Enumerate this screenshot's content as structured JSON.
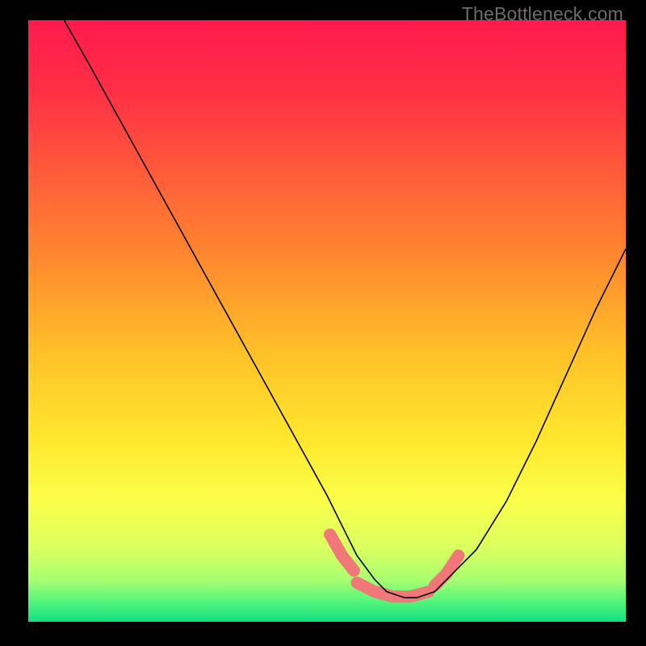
{
  "watermark": "TheBottleneck.com",
  "chart_data": {
    "type": "line",
    "title": "",
    "xlabel": "",
    "ylabel": "",
    "xlim": [
      0,
      100
    ],
    "ylim": [
      0,
      100
    ],
    "grid": false,
    "series": [
      {
        "name": "curve",
        "x": [
          6,
          10,
          15,
          20,
          25,
          30,
          35,
          40,
          45,
          50,
          53,
          55,
          58,
          60,
          63,
          65,
          68,
          70,
          75,
          80,
          85,
          90,
          95,
          100
        ],
        "y": [
          100,
          93,
          84,
          75,
          66,
          57,
          48,
          39,
          30,
          21,
          15,
          11,
          7,
          5,
          4,
          4,
          5,
          7,
          12,
          20,
          30,
          41,
          52,
          62
        ],
        "stroke": "#000000",
        "stroke_width": 1.6
      }
    ],
    "background_gradient": {
      "stops": [
        {
          "offset": 0.0,
          "color": "#ff1a4d"
        },
        {
          "offset": 0.12,
          "color": "#ff3045"
        },
        {
          "offset": 0.25,
          "color": "#ff5a3a"
        },
        {
          "offset": 0.4,
          "color": "#ff8a2e"
        },
        {
          "offset": 0.55,
          "color": "#ffc028"
        },
        {
          "offset": 0.7,
          "color": "#ffe82e"
        },
        {
          "offset": 0.8,
          "color": "#faff4a"
        },
        {
          "offset": 0.88,
          "color": "#d8ff60"
        },
        {
          "offset": 0.93,
          "color": "#a8ff70"
        },
        {
          "offset": 0.965,
          "color": "#58f57a"
        },
        {
          "offset": 1.0,
          "color": "#10e080"
        }
      ]
    },
    "highlight_band": {
      "segments": [
        {
          "x": [
            50.5,
            52.5,
            54.5
          ],
          "y": [
            14.5,
            11,
            8.5
          ]
        },
        {
          "x": [
            55,
            58,
            61,
            64,
            67
          ],
          "y": [
            6.5,
            5,
            4.2,
            4.2,
            5
          ]
        },
        {
          "x": [
            68,
            70,
            72
          ],
          "y": [
            6,
            8,
            11
          ]
        }
      ],
      "color": "#f07878",
      "width": 15
    }
  }
}
